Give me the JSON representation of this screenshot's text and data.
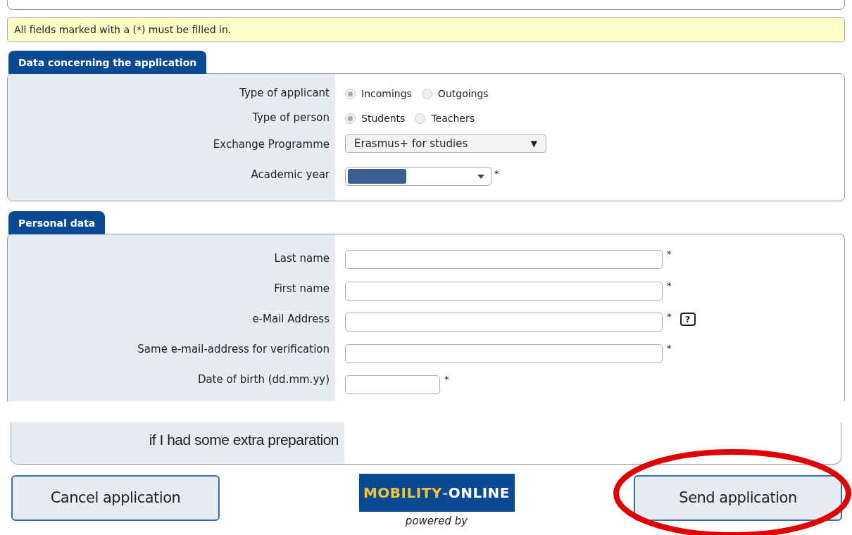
{
  "notice": "All fields marked with a (*) must be filled in.",
  "application_section": {
    "title": "Data concerning the application",
    "radio_rows": [
      {
        "label": "Type of applicant",
        "options": [
          {
            "label": "Incomings",
            "selected": true
          },
          {
            "label": "Outgoings",
            "selected": false
          }
        ]
      },
      {
        "label": "Type of person",
        "options": [
          {
            "label": "Students",
            "selected": true
          },
          {
            "label": "Teachers",
            "selected": false
          }
        ]
      }
    ],
    "programme": {
      "label": "Exchange Programme",
      "value": "Erasmus+ for studies",
      "arrow": "▼"
    },
    "academic_year": {
      "label": "Academic year",
      "required": "*"
    }
  },
  "personal_section": {
    "title": "Personal data",
    "fields": [
      {
        "label": "Last name",
        "required": "*",
        "kind": "wide"
      },
      {
        "label": "First name",
        "required": "*",
        "kind": "wide"
      },
      {
        "label": "e-Mail Address",
        "required": "*",
        "kind": "wide",
        "help": "?"
      },
      {
        "label": "Same e-mail-address for verification",
        "required": "*",
        "kind": "wide"
      },
      {
        "label": "Date of birth (dd.mm.yy)",
        "required": "*",
        "kind": "short"
      }
    ]
  },
  "fragment": {
    "text": "if I had some extra preparation"
  },
  "buttons": [
    {
      "label": "Cancel application",
      "highlighted": false
    },
    {
      "label": "Send application",
      "highlighted": true
    }
  ],
  "logo": {
    "first": "MOBILITY",
    "sep": "-",
    "second": "ONLINE",
    "caption": "powered by"
  }
}
